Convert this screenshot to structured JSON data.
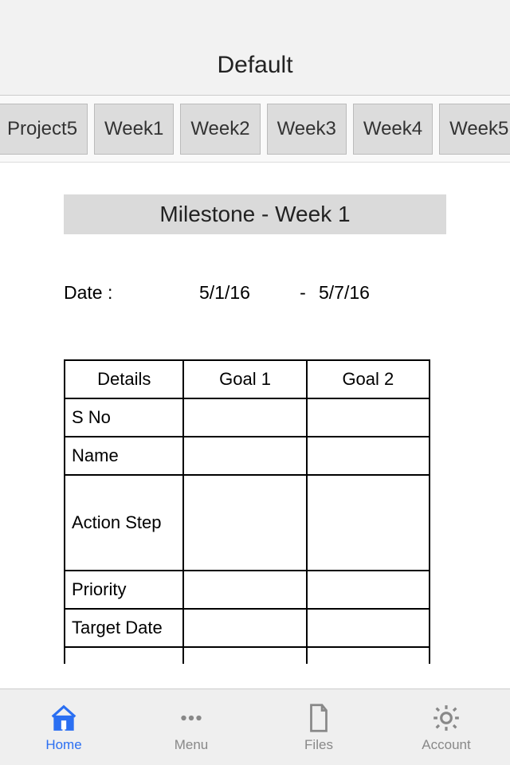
{
  "header": {
    "title": "Default"
  },
  "tabs": {
    "items": [
      "Project5",
      "Week1",
      "Week2",
      "Week3",
      "Week4",
      "Week5"
    ]
  },
  "content": {
    "milestone_title": "Milestone - Week 1",
    "date_label": "Date :",
    "date_start": "5/1/16",
    "date_sep": "-",
    "date_end": "5/7/16",
    "table": {
      "headers": [
        "Details",
        "Goal 1",
        "Goal 2"
      ],
      "rows": [
        {
          "label": "S No",
          "g1": "",
          "g2": ""
        },
        {
          "label": "Name",
          "g1": "",
          "g2": ""
        },
        {
          "label": "Action Step",
          "g1": "",
          "g2": "",
          "tall": true
        },
        {
          "label": "Priority",
          "g1": "",
          "g2": ""
        },
        {
          "label": "Target Date",
          "g1": "",
          "g2": ""
        }
      ]
    }
  },
  "tabbar": {
    "items": [
      {
        "label": "Home",
        "icon": "home-icon",
        "active": true
      },
      {
        "label": "Menu",
        "icon": "dots-icon",
        "active": false
      },
      {
        "label": "Files",
        "icon": "file-icon",
        "active": false
      },
      {
        "label": "Account",
        "icon": "gear-icon",
        "active": false
      }
    ]
  }
}
